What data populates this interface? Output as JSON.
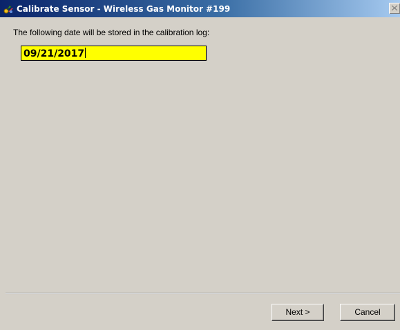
{
  "window": {
    "title": "Calibrate Sensor - Wireless Gas Monitor #199",
    "icon": "sensor-app-icon",
    "close_icon": "close-icon"
  },
  "content": {
    "prompt": "The following date will be stored in the calibration log:",
    "date_value": "09/21/2017",
    "date_field_color": "#ffff00"
  },
  "buttons": {
    "next_label": "Next >",
    "cancel_label": "Cancel"
  },
  "colors": {
    "titlebar_start": "#0a246a",
    "titlebar_end": "#a6caf0",
    "dialog_face": "#d4d0c8"
  }
}
